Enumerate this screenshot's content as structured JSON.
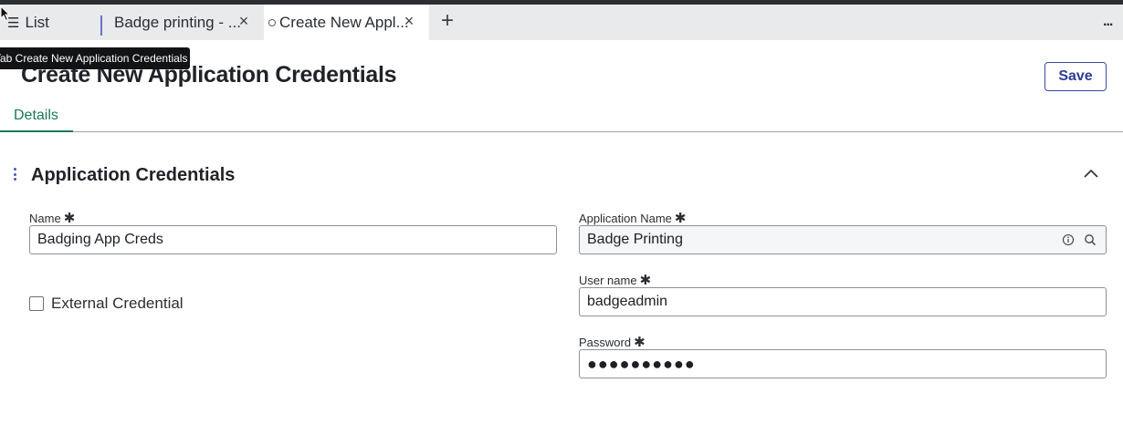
{
  "tabs": [
    {
      "label": "List",
      "icon": "list-icon"
    },
    {
      "label": "Badge printing - ...",
      "icon": "close-icon"
    },
    {
      "label": "Create New Appl...",
      "icon": "close-icon",
      "active": true
    }
  ],
  "tabbar": {
    "new_tab": "+",
    "more": "..."
  },
  "tooltip": "Tab Create New Application Credentials",
  "page": {
    "title": "Create New Application Credentials",
    "save_label": "Save"
  },
  "form_tabs": [
    {
      "label": "Details",
      "active": true
    }
  ],
  "section": {
    "title": "Application Credentials"
  },
  "fields": {
    "name": {
      "label": "Name",
      "value": "Badging App Creds",
      "required": "✱"
    },
    "application_name": {
      "label": "Application Name",
      "value": "Badge Printing",
      "required": "✱"
    },
    "user_name": {
      "label": "User name",
      "value": "badgeadmin",
      "required": "✱"
    },
    "password": {
      "label": "Password",
      "value": "●●●●●●●●●●",
      "required": "✱"
    },
    "external_credential": {
      "label": "External Credential",
      "checked": false
    }
  },
  "colors": {
    "accent": "#2f3c9a",
    "tab_green": "#1a7a55",
    "topstrip": "#2b2f33"
  }
}
